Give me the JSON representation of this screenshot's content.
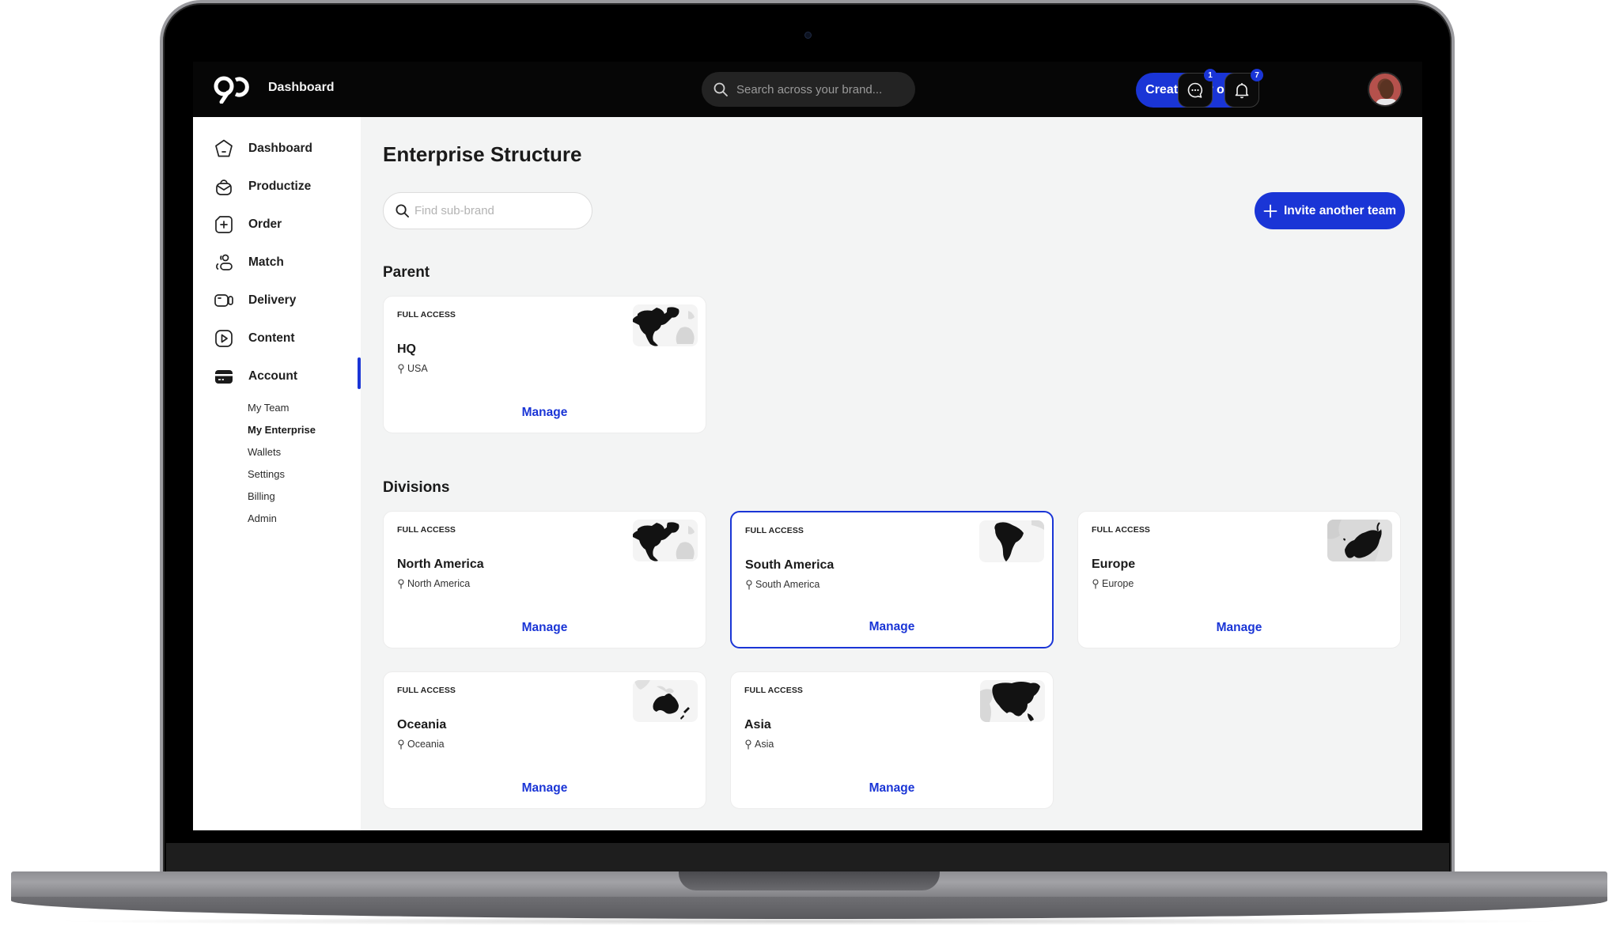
{
  "topbar": {
    "title": "Dashboard",
    "search_placeholder": "Search across your brand...",
    "create_order_label": "Create new order",
    "messages_badge": "1",
    "notifications_badge": "7"
  },
  "sidebar": {
    "items": [
      {
        "label": "Dashboard",
        "icon": "home-pentagon-icon"
      },
      {
        "label": "Productize",
        "icon": "bag-icon"
      },
      {
        "label": "Order",
        "icon": "order-plus-icon"
      },
      {
        "label": "Match",
        "icon": "people-icon"
      },
      {
        "label": "Delivery",
        "icon": "video-camera-icon"
      },
      {
        "label": "Content",
        "icon": "play-icon"
      },
      {
        "label": "Account",
        "icon": "card-icon"
      }
    ],
    "active_item": "Account",
    "sub_items": [
      {
        "label": "My Team"
      },
      {
        "label": "My Enterprise"
      },
      {
        "label": "Wallets"
      },
      {
        "label": "Settings"
      },
      {
        "label": "Billing"
      },
      {
        "label": "Admin"
      }
    ],
    "active_sub_item": "My Enterprise"
  },
  "main": {
    "title": "Enterprise Structure",
    "search_placeholder": "Find sub-brand",
    "invite_label": "Invite another team",
    "parent_section": "Parent",
    "divisions_section": "Divisions",
    "parent": {
      "access": "FULL ACCESS",
      "name": "HQ",
      "location": "USA",
      "map": "north-america",
      "action": "Manage"
    },
    "divisions": [
      {
        "access": "FULL ACCESS",
        "name": "North America",
        "location": "North America",
        "map": "north-america",
        "action": "Manage"
      },
      {
        "access": "FULL ACCESS",
        "name": "South America",
        "location": "South America",
        "map": "south-america",
        "action": "Manage",
        "selected": true
      },
      {
        "access": "FULL ACCESS",
        "name": "Europe",
        "location": "Europe",
        "map": "europe",
        "action": "Manage"
      },
      {
        "access": "FULL ACCESS",
        "name": "Oceania",
        "location": "Oceania",
        "map": "oceania",
        "action": "Manage"
      },
      {
        "access": "FULL ACCESS",
        "name": "Asia",
        "location": "Asia",
        "map": "asia",
        "action": "Manage"
      }
    ]
  },
  "colors": {
    "accent": "#1a35d6",
    "topbar_bg": "#060606",
    "main_bg": "#f3f4f4"
  }
}
